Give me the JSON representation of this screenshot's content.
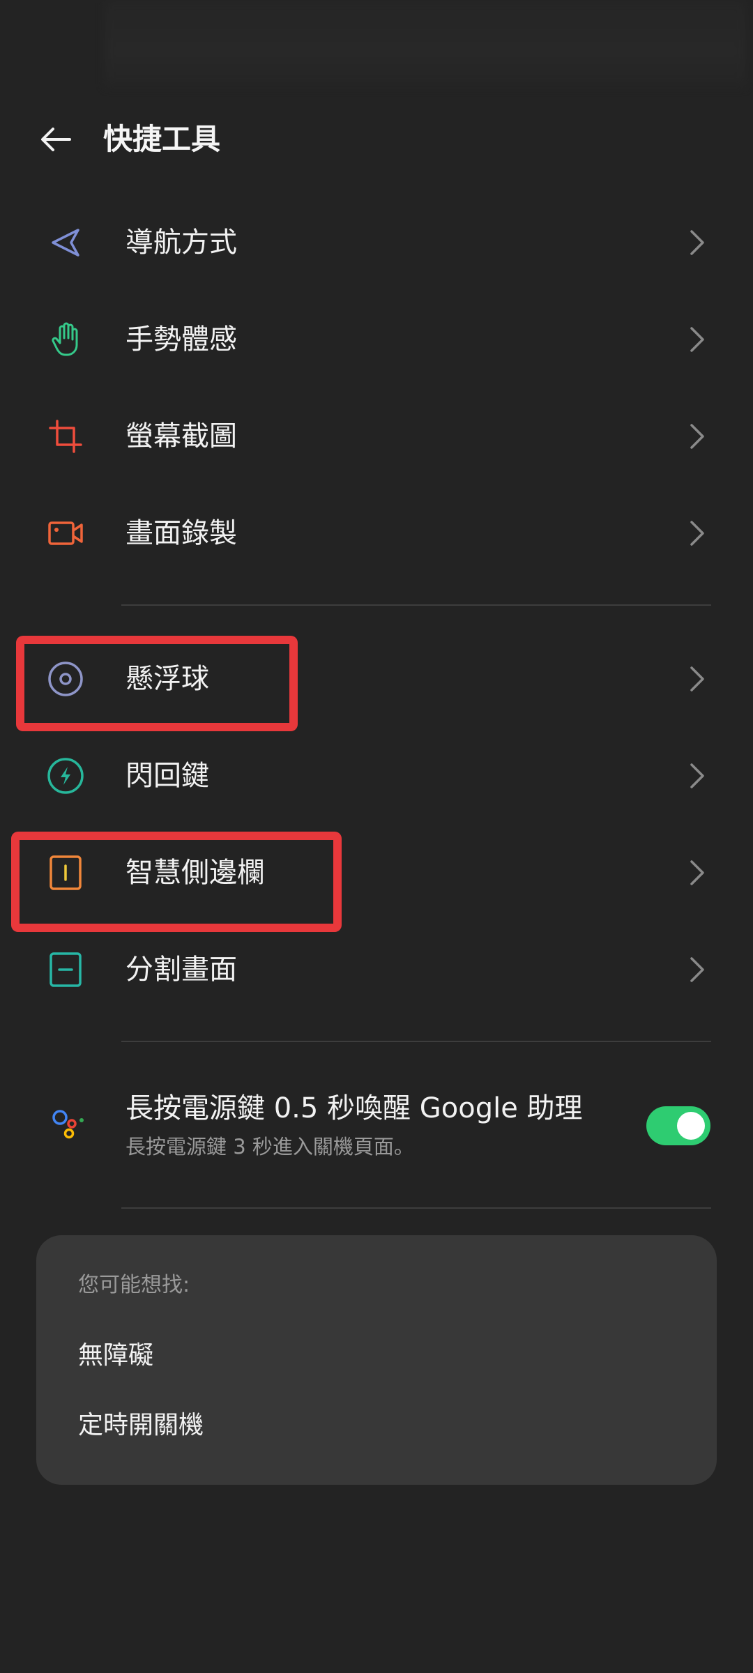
{
  "header": {
    "title": "快捷工具",
    "back_icon": "arrow-left-icon"
  },
  "menu_group_1": [
    {
      "label": "導航方式",
      "icon": "navigation-arrow-icon",
      "icon_color": "#7f8fd6"
    },
    {
      "label": "手勢體感",
      "icon": "hand-gesture-icon",
      "icon_color": "#35c98a"
    },
    {
      "label": "螢幕截圖",
      "icon": "crop-screenshot-icon",
      "icon_color": "#ef4d3c"
    },
    {
      "label": "畫面錄製",
      "icon": "video-camera-icon",
      "icon_color": "#f0643a"
    }
  ],
  "menu_group_2": [
    {
      "label": "懸浮球",
      "icon": "floating-ball-icon",
      "icon_color": "#8e95c8"
    },
    {
      "label": "閃回鍵",
      "icon": "flash-bolt-icon",
      "icon_color": "#27b79b"
    },
    {
      "label": "智慧側邊欄",
      "icon": "smart-sidebar-icon",
      "icon_color": "#f0863a"
    },
    {
      "label": "分割畫面",
      "icon": "split-screen-icon",
      "icon_color": "#27b7a6"
    }
  ],
  "assistant": {
    "title": "長按電源鍵 0.5 秒喚醒 Google 助理",
    "subtitle": "長按電源鍵 3 秒進入關機頁面。",
    "icon": "google-assistant-icon",
    "toggle_on": true,
    "toggle_color": "#2ecc71"
  },
  "suggestions": {
    "heading": "您可能想找:",
    "links": [
      "無障礙",
      "定時開關機"
    ]
  },
  "highlight_color": "#e8383b"
}
